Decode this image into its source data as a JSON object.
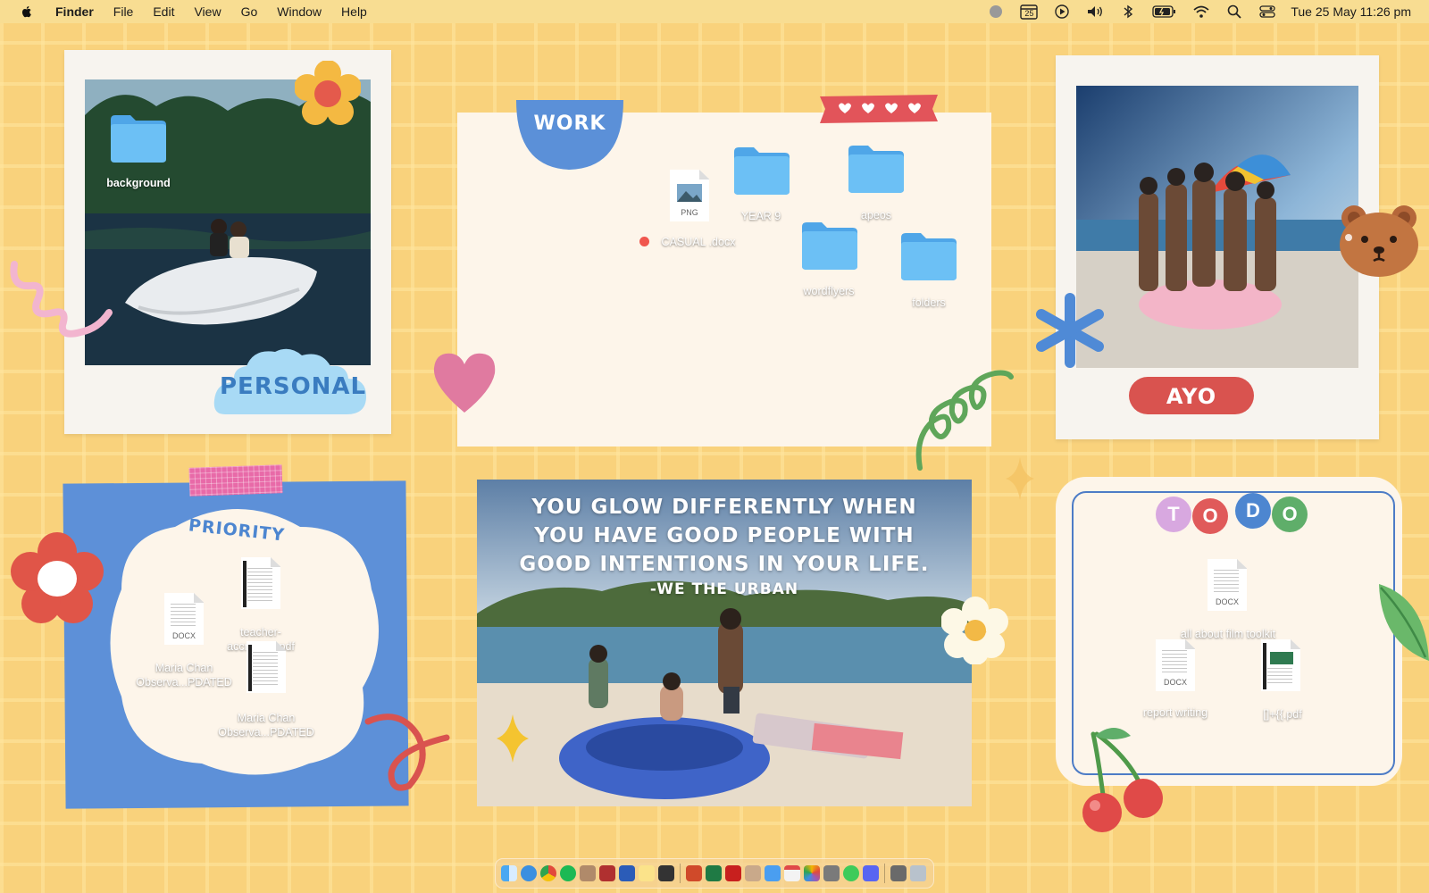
{
  "menubar": {
    "app_name": "Finder",
    "menus": [
      "File",
      "Edit",
      "View",
      "Go",
      "Window",
      "Help"
    ],
    "calendar_day": "25",
    "clock": "Tue 25 May  11:26 pm"
  },
  "stickers": {
    "personal": "PERSONAL",
    "work": "WORK",
    "ayo": "AYO",
    "priority": "PRIORITY",
    "todo_letters": [
      "T",
      "O",
      "D",
      "O"
    ]
  },
  "quote": {
    "line1": "YOU GLOW DIFFERENTLY WHEN",
    "line2": "YOU HAVE GOOD PEOPLE WITH",
    "line3": "GOOD INTENTIONS IN YOUR LIFE.",
    "author": "-WE THE URBAN"
  },
  "desktop_items": {
    "background": "background",
    "png_ext": "PNG",
    "casual": "CASUAL .docx",
    "year9": "YEAR 9",
    "apeos": "apeos",
    "wordflyers": "wordflyers",
    "folders": "folders",
    "docx_ext": "DOCX",
    "maria1": "Maria Chan Observa...PDATED",
    "teacher": "teacher-accred...e.pdf",
    "maria2": "Maria Chan Observa...PDATED",
    "film": "all about film toolkit",
    "report": "report writing",
    "pdf2": "[]+{{.pdf"
  },
  "colors": {
    "desktop": "#f9d27c",
    "folder_blue": "#5db6f2",
    "work_blue": "#5b90d8",
    "ayo_red": "#d9534f",
    "priority_blue": "#5d90d8",
    "cream": "#fdf5ea",
    "pink": "#e07aa0"
  }
}
